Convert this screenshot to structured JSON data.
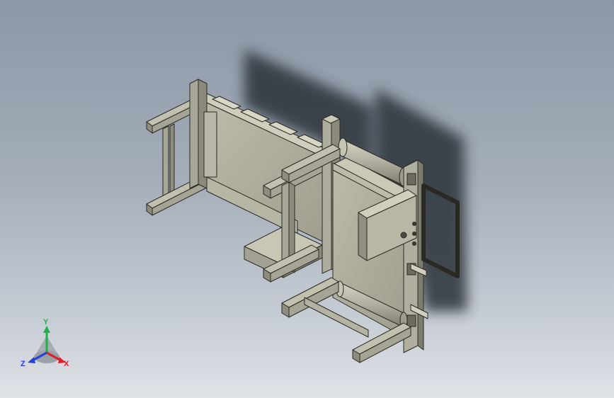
{
  "viewport": {
    "background_top": "#8c97a6",
    "background_bottom": "#dfe2e6",
    "part_color": "#b4b2a0",
    "shadow_color": "#2c3138"
  },
  "triad": {
    "x_label": "X",
    "y_label": "Y",
    "z_label": "Z",
    "x_color": "#e0202a",
    "y_color": "#21b04a",
    "z_color": "#2540d8"
  }
}
